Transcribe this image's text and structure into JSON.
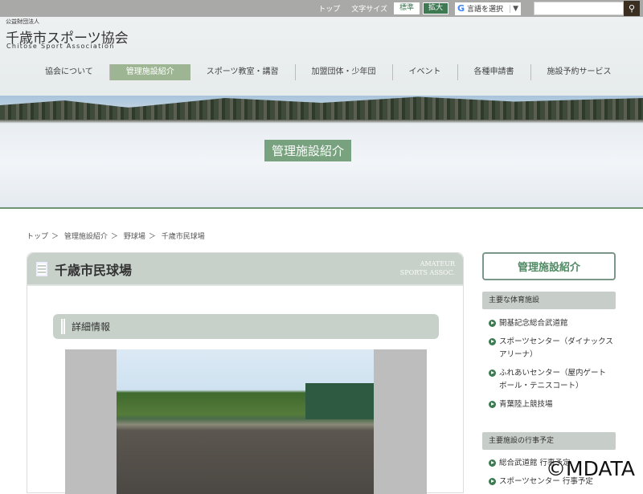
{
  "topbar": {
    "top": "トップ",
    "font_size": "文字サイズ",
    "std": "標準",
    "big": "拡大",
    "lang": "言語を選択",
    "search_placeholder": ""
  },
  "header": {
    "org": "公益財団法人",
    "title": "千歳市スポーツ協会",
    "subtitle": "Chitose Sport Association"
  },
  "nav": [
    "協会について",
    "管理施設紹介",
    "スポーツ教室・講習",
    "加盟団体・少年団",
    "イベント",
    "各種申請書",
    "施設予約サービス"
  ],
  "hero": {
    "title": "管理施設紹介"
  },
  "breadcrumb": [
    "トップ",
    "＞",
    "管理施設紹介",
    "＞",
    "野球場",
    "＞",
    "千歳市民球場"
  ],
  "card": {
    "title": "千歳市民球場",
    "deco": "AMATEUR",
    "deco2": "SPORTS ASSOC.",
    "section": "詳細情報"
  },
  "sidebar": {
    "button": "管理施設紹介",
    "h1": "主要な体育施設",
    "items1": [
      "開基記念総合武道館",
      "スポーツセンター（ダイナックスアリーナ）",
      "ふれあいセンター（屋内ゲートボール・テニスコート）",
      "青葉陸上競技場"
    ],
    "h2": "主要施設の行事予定",
    "items2": [
      "総合武道館 行事予定",
      "スポーツセンター 行事予定"
    ]
  },
  "watermark": "©MDATA",
  "colors": {
    "accent": "#3d7a52",
    "nav_active": "#9db593"
  }
}
